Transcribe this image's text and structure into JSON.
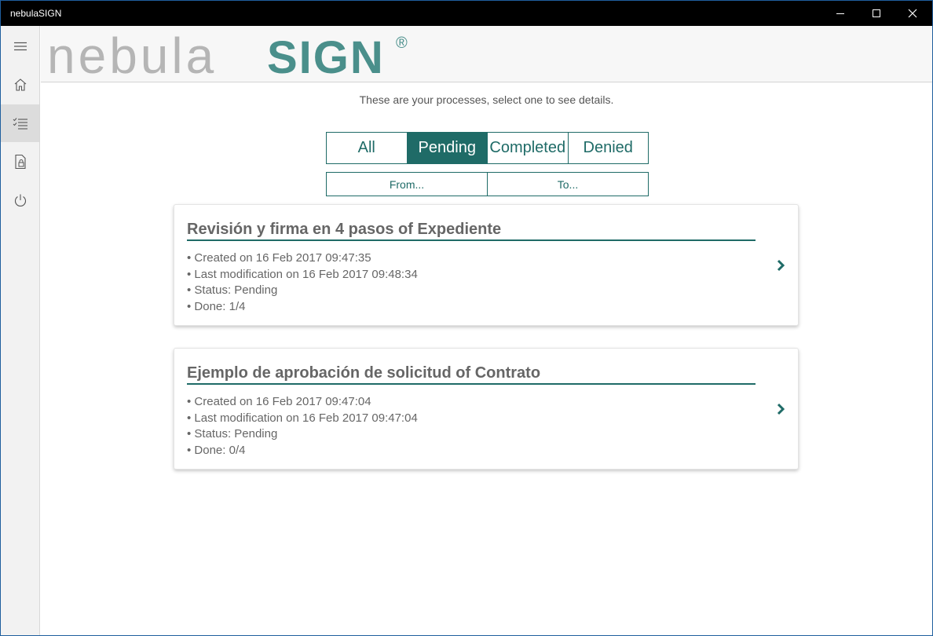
{
  "window": {
    "title": "nebulaSIGN",
    "controls": {
      "minimize_icon": "minimize-icon",
      "maximize_icon": "maximize-icon",
      "close_icon": "close-icon"
    }
  },
  "sidebar": {
    "items": [
      {
        "icon": "hamburger-menu-icon"
      },
      {
        "icon": "home-icon"
      },
      {
        "icon": "task-list-icon",
        "active": true
      },
      {
        "icon": "document-lock-icon"
      },
      {
        "icon": "power-icon"
      }
    ]
  },
  "header": {
    "logo_light": "nebula",
    "logo_bold": "SIGN",
    "logo_mark": "®"
  },
  "main": {
    "subtitle": "These are your processes, select one to see details.",
    "filters": [
      "All",
      "Pending",
      "Completed",
      "Denied"
    ],
    "active_filter": "Pending",
    "date_from": "From...",
    "date_to": "To..."
  },
  "processes": [
    {
      "title": "Revisión y firma en 4 pasos of Expediente",
      "created": "• Created on 16 Feb 2017 09:47:35",
      "modified": "• Last modification on 16 Feb 2017 09:48:34",
      "status": "• Status: Pending",
      "done": "• Done: 1/4"
    },
    {
      "title": "Ejemplo de aprobación de solicitud of Contrato",
      "created": "• Created on 16 Feb 2017 09:47:04",
      "modified": "• Last modification on 16 Feb 2017 09:47:04",
      "status": "• Status: Pending",
      "done": "• Done: 0/4"
    }
  ],
  "colors": {
    "accent": "#1f6b67",
    "logo_gray": "#b5b5b5",
    "logo_teal": "#4a8f8b",
    "titlebar": "#000000"
  }
}
